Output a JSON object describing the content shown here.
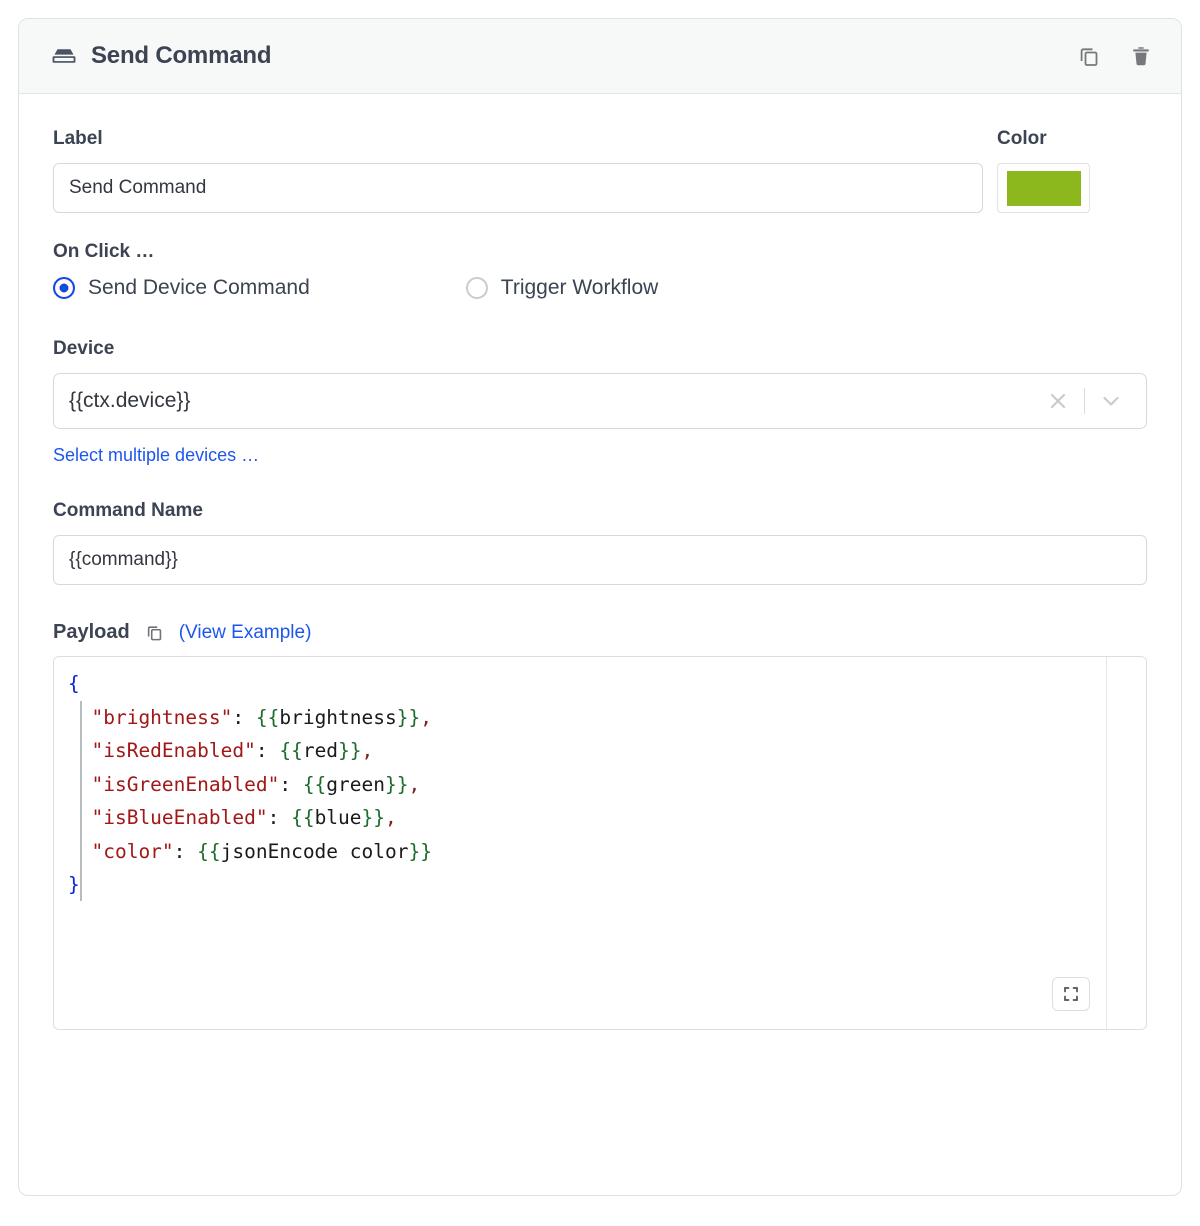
{
  "header": {
    "icon": "button-block-icon",
    "title": "Send Command",
    "duplicate_icon": "copy-icon",
    "delete_icon": "trash-icon"
  },
  "label_field": {
    "label": "Label",
    "value": "Send Command",
    "placeholder": "Label"
  },
  "color_field": {
    "label": "Color",
    "value": "#8cb81e"
  },
  "on_click": {
    "label": "On Click …",
    "options": [
      {
        "label": "Send Device Command",
        "selected": true
      },
      {
        "label": "Trigger Workflow",
        "selected": false
      }
    ]
  },
  "device_field": {
    "label": "Device",
    "value": "{{ctx.device}}",
    "clear_icon": "close-icon",
    "dropdown_icon": "chevron-down-icon",
    "multi_link": "Select multiple devices …"
  },
  "command_field": {
    "label": "Command Name",
    "value": "{{command}}",
    "placeholder": "Command Name"
  },
  "payload": {
    "label": "Payload",
    "copy_icon": "copy-icon",
    "example_link": "(View Example)",
    "expand_icon": "expand-icon",
    "code_lines": [
      {
        "segments": [
          {
            "t": "{",
            "c": "brace"
          }
        ]
      },
      {
        "segments": [
          {
            "t": "  ",
            "c": "plain"
          },
          {
            "t": "\"brightness\"",
            "c": "str"
          },
          {
            "t": ": ",
            "c": "plain"
          },
          {
            "t": "{{",
            "c": "mus"
          },
          {
            "t": "brightness",
            "c": "plain"
          },
          {
            "t": "}}",
            "c": "mus"
          },
          {
            "t": ",",
            "c": "comma"
          }
        ]
      },
      {
        "segments": [
          {
            "t": "  ",
            "c": "plain"
          },
          {
            "t": "\"isRedEnabled\"",
            "c": "str"
          },
          {
            "t": ": ",
            "c": "plain"
          },
          {
            "t": "{{",
            "c": "mus"
          },
          {
            "t": "red",
            "c": "plain"
          },
          {
            "t": "}}",
            "c": "mus"
          },
          {
            "t": ",",
            "c": "comma"
          }
        ]
      },
      {
        "segments": [
          {
            "t": "  ",
            "c": "plain"
          },
          {
            "t": "\"isGreenEnabled\"",
            "c": "str"
          },
          {
            "t": ": ",
            "c": "plain"
          },
          {
            "t": "{{",
            "c": "mus"
          },
          {
            "t": "green",
            "c": "plain"
          },
          {
            "t": "}}",
            "c": "mus"
          },
          {
            "t": ",",
            "c": "comma"
          }
        ]
      },
      {
        "segments": [
          {
            "t": "  ",
            "c": "plain"
          },
          {
            "t": "\"isBlueEnabled\"",
            "c": "str"
          },
          {
            "t": ": ",
            "c": "plain"
          },
          {
            "t": "{{",
            "c": "mus"
          },
          {
            "t": "blue",
            "c": "plain"
          },
          {
            "t": "}}",
            "c": "mus"
          },
          {
            "t": ",",
            "c": "comma"
          }
        ]
      },
      {
        "segments": [
          {
            "t": "  ",
            "c": "plain"
          },
          {
            "t": "\"color\"",
            "c": "str"
          },
          {
            "t": ": ",
            "c": "plain"
          },
          {
            "t": "{{",
            "c": "mus"
          },
          {
            "t": "jsonEncode color",
            "c": "plain"
          },
          {
            "t": "}}",
            "c": "mus"
          }
        ]
      },
      {
        "segments": [
          {
            "t": "}",
            "c": "brace"
          }
        ]
      }
    ]
  },
  "colors": {
    "accent_link": "#1d56ef",
    "radio_selected": "#1449e0",
    "swatch": "#8cb81e",
    "text": "#3c4352"
  }
}
